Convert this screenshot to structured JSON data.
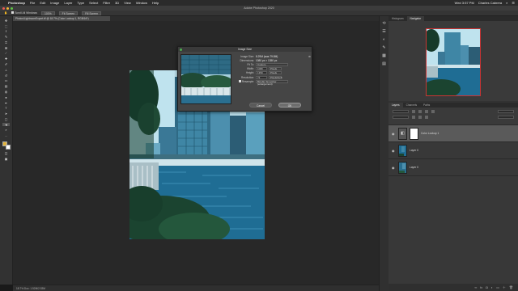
{
  "menubar": {
    "app_name": "Photoshop",
    "items": [
      "File",
      "Edit",
      "Image",
      "Layer",
      "Type",
      "Select",
      "Filter",
      "3D",
      "View",
      "Window",
      "Help"
    ],
    "clock": "Wed 3:57 PM",
    "user": "Charles Cabrera"
  },
  "window": {
    "title": "Adobe Photoshop 2020"
  },
  "options_bar": {
    "scroll_all_windows": "Scroll All Windows",
    "zoom_100": "100%",
    "fit_screen": "Fit Screen",
    "fill_screen": "Fill Screen"
  },
  "document": {
    "tab_title": "Photos/LightroomExport.tif @ 18.7% (Color Lookup 1, RGB/16*)",
    "status": "18.7%    Doc: 1.52M/2.53M"
  },
  "dialog": {
    "title": "Image Size",
    "image_size": "Image Size:",
    "image_size_value": "8.29M (was 79.8M)",
    "dimensions": "Dimensions:",
    "dimensions_value": "1080 px × 1350 px",
    "fit_to": "Fit To:",
    "fit_to_value": "Custom",
    "width": "Width:",
    "width_value": "1080",
    "width_unit": "Pixels",
    "height": "Height:",
    "height_value": "1350",
    "height_unit": "Pixels",
    "resolution": "Resolution:",
    "resolution_value": "72",
    "resolution_unit": "Pixels/Inch",
    "resample": "Resample:",
    "resample_value": "Bicubic Smoother (enlargement)",
    "cancel": "Cancel",
    "ok": "OK"
  },
  "panels": {
    "top_tabs": [
      "Histogram",
      "Navigator"
    ],
    "layer_tabs": [
      "Layers",
      "Channels",
      "Paths"
    ],
    "layers": [
      {
        "name": "Color Lookup 1",
        "selected": true
      },
      {
        "name": "Layer 0",
        "selected": false
      },
      {
        "name": "Layer 0",
        "selected": false
      }
    ]
  },
  "colors": {
    "foreground": "#e2b33a",
    "background": "#ffffff"
  }
}
